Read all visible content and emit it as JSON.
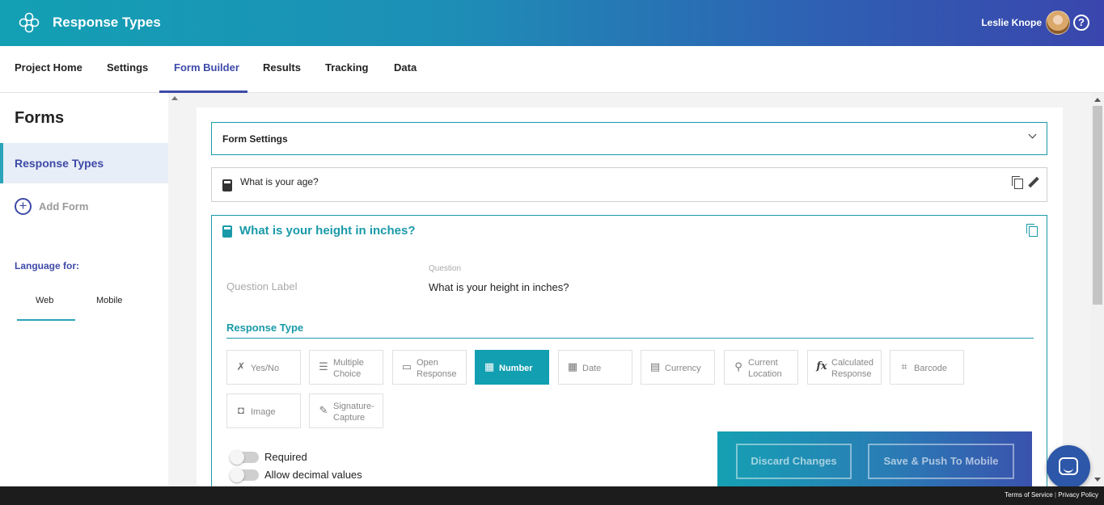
{
  "header": {
    "app_title": "Response Types",
    "user_name": "Leslie Knope",
    "help_glyph": "?"
  },
  "nav": {
    "tabs": [
      {
        "label": "Project Home"
      },
      {
        "label": "Settings"
      },
      {
        "label": "Form Builder",
        "active": true
      },
      {
        "label": "Results"
      },
      {
        "label": "Tracking"
      },
      {
        "label": "Data"
      }
    ]
  },
  "sidebar": {
    "title": "Forms",
    "active_form": "Response Types",
    "add_form_label": "Add Form",
    "language_label": "Language for:",
    "language_tabs": [
      "Web",
      "Mobile"
    ],
    "language_selected": "Web"
  },
  "main": {
    "form_settings_label": "Form Settings",
    "collapsed_question": "What is your age?",
    "expanded_question": {
      "title": "What is your height in inches?",
      "question_label_placeholder": "Question Label",
      "question_field_label": "Question",
      "question_value": "What is your height in inches?",
      "response_type_heading": "Response Type",
      "response_types": [
        {
          "label": "Yes/No",
          "icon": "yes-no-icon",
          "glyph": "✗"
        },
        {
          "label": "Multiple Choice",
          "icon": "list-icon",
          "glyph": "☰"
        },
        {
          "label": "Open Response",
          "icon": "text-box-icon",
          "glyph": "▭"
        },
        {
          "label": "Number",
          "icon": "calculator-icon",
          "glyph": "▦",
          "active": true
        },
        {
          "label": "Date",
          "icon": "calendar-icon",
          "glyph": "▦"
        },
        {
          "label": "Currency",
          "icon": "currency-icon",
          "glyph": "▤"
        },
        {
          "label": "Current Location",
          "icon": "location-pin-icon",
          "glyph": "⚲"
        },
        {
          "label": "Calculated Response",
          "icon": "function-icon",
          "glyph": "fx"
        },
        {
          "label": "Barcode",
          "icon": "barcode-icon",
          "glyph": "⌗"
        },
        {
          "label": "Image",
          "icon": "camera-icon",
          "glyph": "◘"
        },
        {
          "label": "Signature-Capture",
          "icon": "pen-icon",
          "glyph": "✎"
        }
      ],
      "toggles": [
        {
          "label": "Required",
          "on": false
        },
        {
          "label": "Allow decimal values",
          "on": false
        }
      ]
    }
  },
  "actions": {
    "discard_label": "Discard Changes",
    "save_label": "Save & Push To Mobile"
  },
  "footer": {
    "terms": "Terms of Service",
    "separator": "|",
    "privacy": "Privacy Policy"
  }
}
